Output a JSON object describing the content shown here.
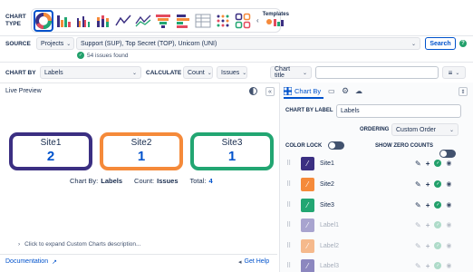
{
  "chart_type": {
    "label_line1": "CHART",
    "label_line2": "TYPE",
    "templates_label": "Templates"
  },
  "source": {
    "label": "SOURCE",
    "type_value": "Projects",
    "query_value": "Support (SUP), Top Secret (TOP), Unicorn (UNI)",
    "search_button": "Search",
    "issues_found": "54 issues found"
  },
  "controls": {
    "chart_by_label": "CHART BY",
    "chart_by_value": "Labels",
    "calculate_label": "CALCULATE",
    "calculate_value": "Count",
    "calculate_field": "Issues",
    "chart_title_button": "Chart title",
    "chart_title_placeholder": ""
  },
  "preview": {
    "title": "Live Preview",
    "cards": [
      {
        "name": "Site1",
        "value": "2",
        "color": "#3b2f82"
      },
      {
        "name": "Site2",
        "value": "1",
        "color": "#f58a3a"
      },
      {
        "name": "Site3",
        "value": "1",
        "color": "#22a672"
      }
    ],
    "footer": {
      "chart_by_prefix": "Chart By:",
      "chart_by_value": "Labels",
      "count_prefix": "Count:",
      "count_value": "Issues",
      "total_prefix": "Total:",
      "total_value": "4"
    },
    "expand_text": "Click to expand Custom Charts description...",
    "documentation_link": "Documentation",
    "get_help_link": "Get Help"
  },
  "panel": {
    "tab_label": "Chart By",
    "chart_by_label_field_label": "CHART BY LABEL",
    "chart_by_label_field_value": "Labels",
    "ordering_label": "ORDERING",
    "ordering_value": "Custom Order",
    "color_lock_label": "COLOR LOCK",
    "show_zero_counts_label": "SHOW ZERO COUNTS",
    "rows": [
      {
        "name": "Site1",
        "color": "#3b2f82",
        "dimmed": false
      },
      {
        "name": "Site2",
        "color": "#f58a3a",
        "dimmed": false
      },
      {
        "name": "Site3",
        "color": "#22a672",
        "dimmed": false
      },
      {
        "name": "Label1",
        "color": "#a8a4cf",
        "dimmed": true
      },
      {
        "name": "Label2",
        "color": "#f5b98c",
        "dimmed": true
      },
      {
        "name": "Label3",
        "color": "#8c87bf",
        "dimmed": true
      }
    ]
  },
  "icons": {
    "pencil": "✎",
    "plus": "+",
    "check": "✓",
    "eye": "◉",
    "chevron_down": "⌄",
    "external": "↗",
    "megaphone": "📢",
    "drag": "⠿"
  },
  "colors": {
    "accent": "#0052cc",
    "success": "#22a06b"
  }
}
